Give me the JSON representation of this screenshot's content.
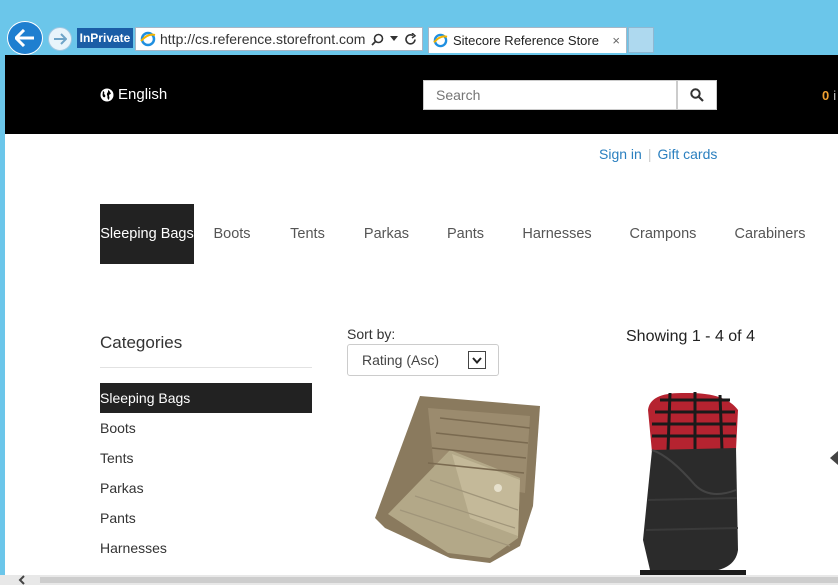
{
  "browser": {
    "badge": "InPrivate",
    "url": "http://cs.reference.storefront.com/s",
    "tab_title": "Sitecore Reference Store",
    "tab_close": "×"
  },
  "header": {
    "language": "English",
    "search_placeholder": "Search",
    "cart_count": "0",
    "cart_label": "i"
  },
  "account_links": {
    "sign_in": "Sign in",
    "separator": "|",
    "gift_cards": "Gift cards"
  },
  "category_nav": [
    {
      "label": "Sleeping Bags",
      "active": true
    },
    {
      "label": "Boots"
    },
    {
      "label": "Tents"
    },
    {
      "label": "Parkas"
    },
    {
      "label": "Pants"
    },
    {
      "label": "Harnesses"
    },
    {
      "label": "Crampons"
    },
    {
      "label": "Carabiners"
    }
  ],
  "sidebar": {
    "title": "Categories",
    "items": [
      {
        "label": "Sleeping Bags",
        "active": true
      },
      {
        "label": "Boots"
      },
      {
        "label": "Tents"
      },
      {
        "label": "Parkas"
      },
      {
        "label": "Pants"
      },
      {
        "label": "Harnesses"
      }
    ]
  },
  "listing": {
    "sort_label": "Sort by:",
    "sort_value": "Rating (Asc)",
    "showing": "Showing 1 - 4 of 4"
  },
  "colors": {
    "chrome": "#6bc6ea",
    "topbar": "#000000",
    "active_nav": "#222222",
    "link": "#2a7fbf",
    "cart_accent": "#f0a030"
  }
}
